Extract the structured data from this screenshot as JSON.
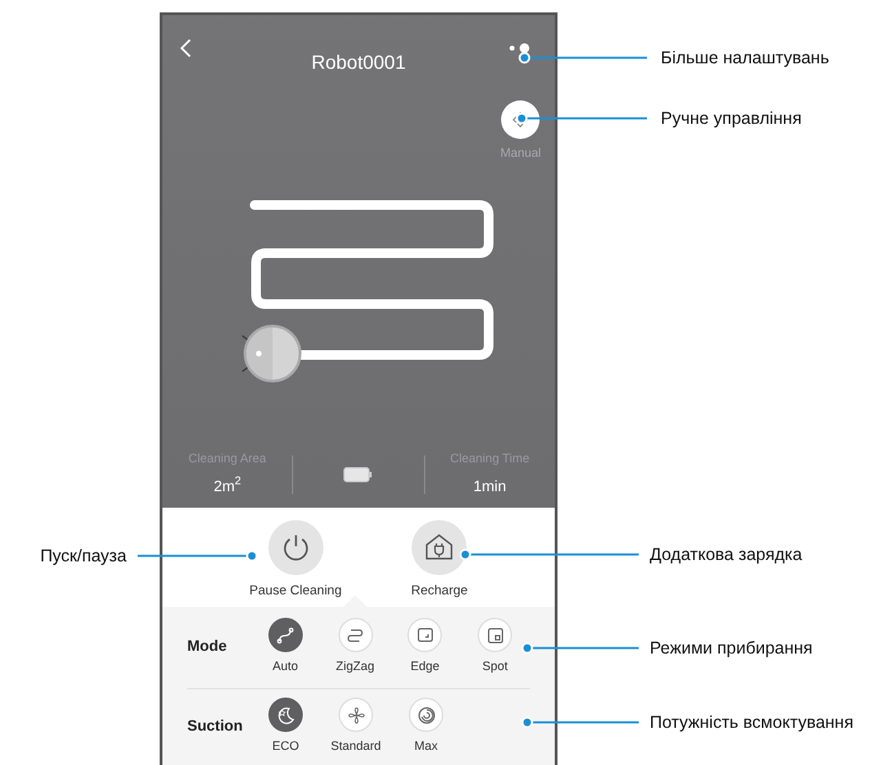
{
  "header": {
    "title": "Robot0001"
  },
  "manual": {
    "label": "Manual"
  },
  "stats": [
    {
      "label": "Cleaning Area",
      "value": "2m$^{2}$"
    },
    {
      "label": "Cleaning Time",
      "value": "1min"
    }
  ],
  "actions": [
    {
      "kind": "power",
      "label": "Pause Cleaning"
    },
    {
      "kind": "recharge",
      "label": "Recharge"
    }
  ],
  "settings": [
    {
      "label": "Mode",
      "options": [
        {
          "kind": "auto",
          "label": "Auto",
          "selected": true
        },
        {
          "kind": "zigzag",
          "label": "ZigZag",
          "selected": false
        },
        {
          "kind": "edge",
          "label": "Edge",
          "selected": false
        },
        {
          "kind": "spot",
          "label": "Spot",
          "selected": false
        }
      ]
    },
    {
      "label": "Suction",
      "options": [
        {
          "kind": "eco",
          "label": "ECO",
          "selected": true
        },
        {
          "kind": "standard",
          "label": "Standard",
          "selected": false
        },
        {
          "kind": "max",
          "label": "Max",
          "selected": false
        }
      ]
    }
  ],
  "callouts": [
    {
      "text": "Більше налаштувань"
    },
    {
      "text": "Ручне управління"
    },
    {
      "text": "Пуск/пауза"
    },
    {
      "text": "Додаткова зарядка"
    },
    {
      "text": "Режими прибирання"
    },
    {
      "text": "Потужність всмоктування"
    }
  ]
}
